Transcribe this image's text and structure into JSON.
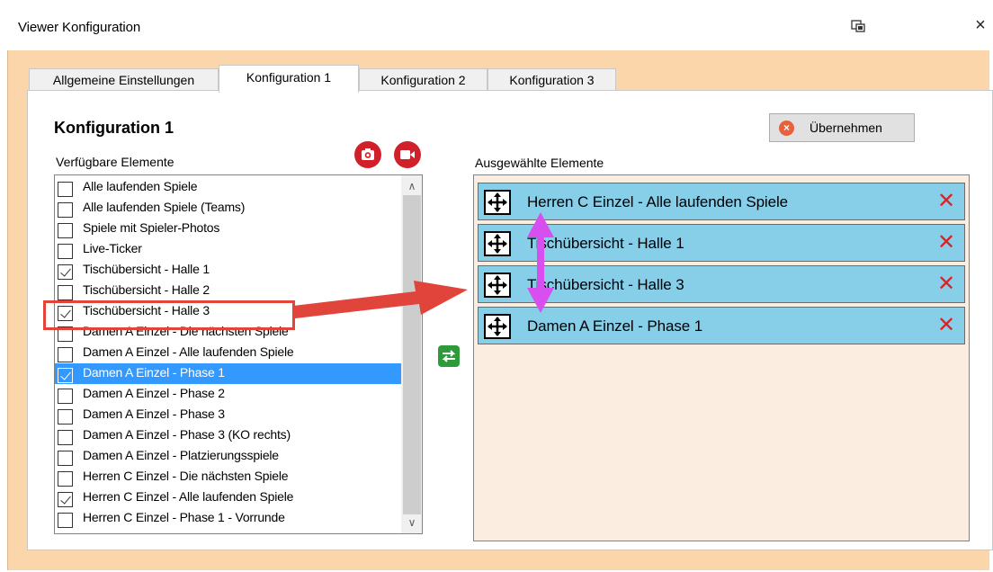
{
  "window": {
    "title": "Viewer Konfiguration",
    "close_glyph": "×",
    "pin_icon": "pin-window-icon"
  },
  "tabs": [
    {
      "label": "Allgemeine Einstellungen",
      "active": false
    },
    {
      "label": "Konfiguration 1",
      "active": true
    },
    {
      "label": "Konfiguration 2",
      "active": false
    },
    {
      "label": "Konfiguration 3",
      "active": false
    }
  ],
  "panel": {
    "heading": "Konfiguration 1",
    "available_label": "Verfügbare Elemente",
    "selected_label": "Ausgewählte Elemente",
    "apply_button": "Übernehmen",
    "apply_icon": "cancel-circle-icon",
    "camera_icon": "camera-icon",
    "video_icon": "video-camera-icon",
    "swap_icon": "swap-arrows-icon"
  },
  "available_items": [
    {
      "label": "Alle laufenden Spiele",
      "checked": false,
      "selected": false
    },
    {
      "label": "Alle laufenden Spiele (Teams)",
      "checked": false,
      "selected": false
    },
    {
      "label": "Spiele mit Spieler-Photos",
      "checked": false,
      "selected": false
    },
    {
      "label": "Live-Ticker",
      "checked": false,
      "selected": false
    },
    {
      "label": "Tischübersicht - Halle 1",
      "checked": true,
      "selected": false
    },
    {
      "label": "Tischübersicht - Halle 2",
      "checked": false,
      "selected": false
    },
    {
      "label": "Tischübersicht - Halle 3",
      "checked": true,
      "selected": false
    },
    {
      "label": "Damen A Einzel - Die nächsten Spiele",
      "checked": false,
      "selected": false
    },
    {
      "label": "Damen A Einzel - Alle laufenden Spiele",
      "checked": false,
      "selected": false
    },
    {
      "label": "Damen A Einzel - Phase 1",
      "checked": true,
      "selected": true
    },
    {
      "label": "Damen A Einzel - Phase 2",
      "checked": false,
      "selected": false
    },
    {
      "label": "Damen A Einzel - Phase 3",
      "checked": false,
      "selected": false
    },
    {
      "label": "Damen A Einzel - Phase 3 (KO rechts)",
      "checked": false,
      "selected": false
    },
    {
      "label": "Damen A Einzel - Platzierungsspiele",
      "checked": false,
      "selected": false
    },
    {
      "label": "Herren C Einzel - Die nächsten Spiele",
      "checked": false,
      "selected": false
    },
    {
      "label": "Herren C Einzel - Alle laufenden Spiele",
      "checked": true,
      "selected": false
    },
    {
      "label": "Herren C Einzel - Phase 1 - Vorrunde",
      "checked": false,
      "selected": false
    }
  ],
  "selected_items": [
    {
      "label": "Herren C Einzel - Alle laufenden Spiele",
      "remove": "✕"
    },
    {
      "label": "Tischübersicht - Halle 1",
      "remove": "✕"
    },
    {
      "label": "Tischübersicht - Halle 3",
      "remove": "✕"
    },
    {
      "label": "Damen A Einzel - Phase 1",
      "remove": "✕"
    }
  ],
  "scrollbar": {
    "up": "∧",
    "down": "∨"
  },
  "colors": {
    "window_background": "#fbd6ab",
    "selected_row": "#3399ff",
    "chosen_item": "#87cee9",
    "chosen_list_background": "#fbeee0",
    "annotation_red": "#e0443a",
    "annotation_magenta": "#d84ff0",
    "remove_red": "#e02020",
    "round_button_red": "#d0202a",
    "swap_green": "#2e9a3a"
  }
}
